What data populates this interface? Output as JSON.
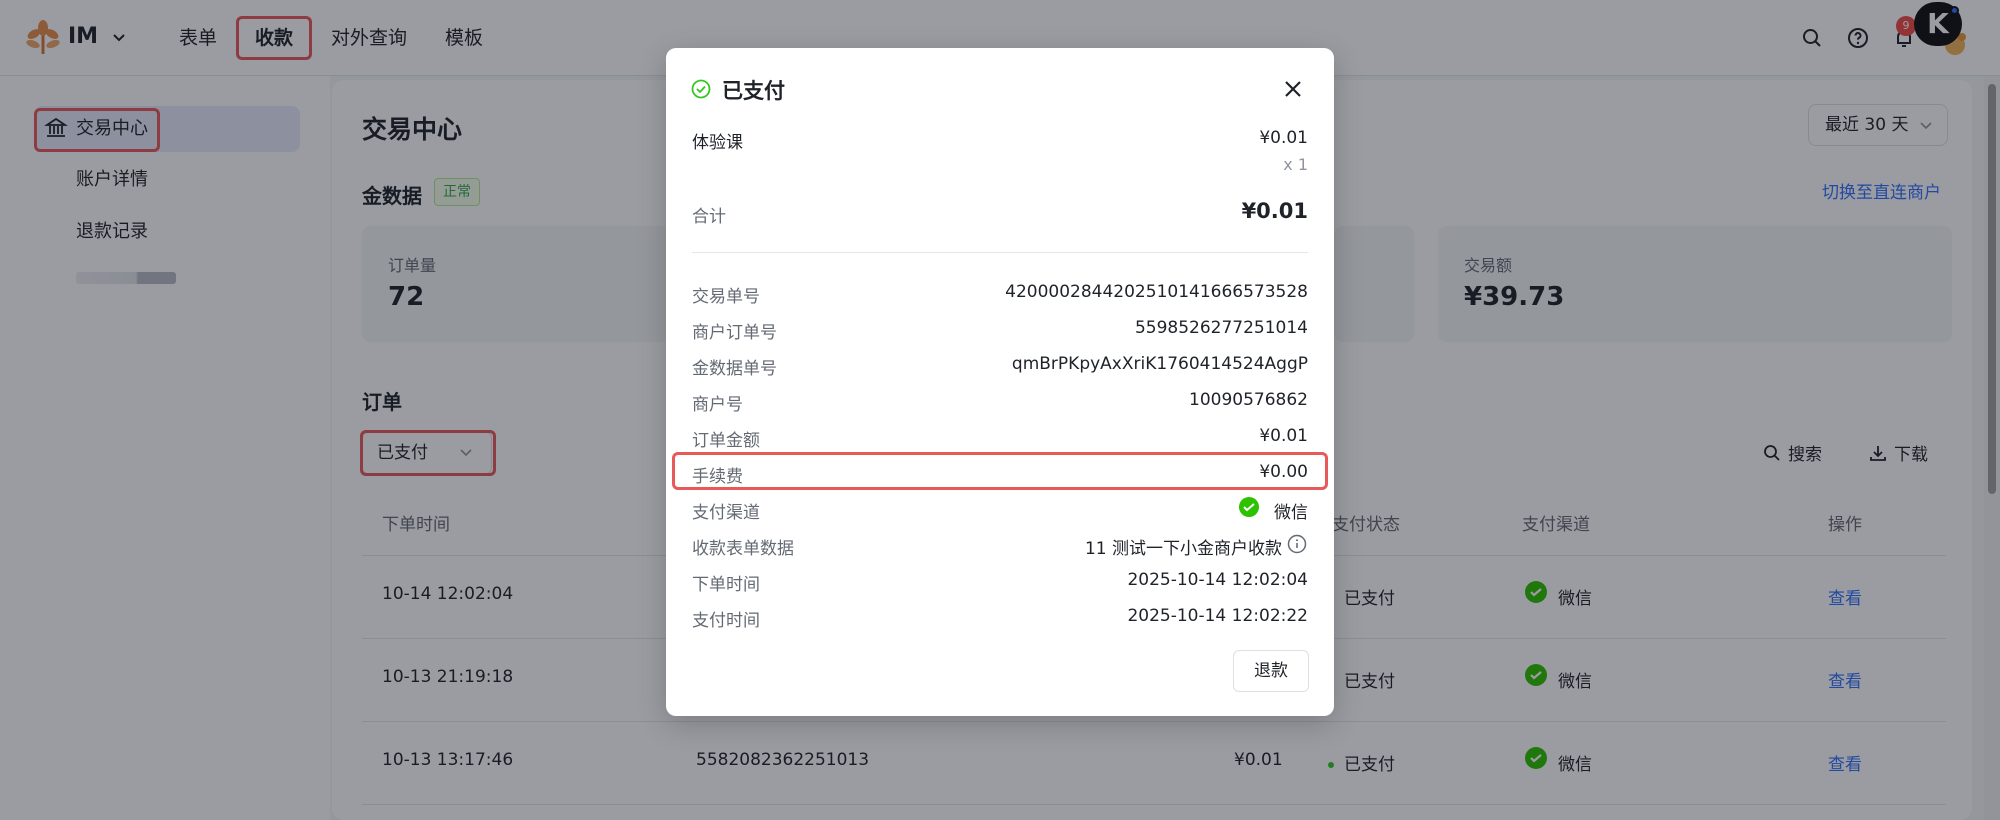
{
  "app": {
    "name": "IM"
  },
  "nav": [
    "表单",
    "收款",
    "对外查询",
    "模板"
  ],
  "header": {
    "notification_count": "9",
    "avatar_letter": "K"
  },
  "sidebar": {
    "items": [
      "交易中心",
      "账户详情",
      "退款记录"
    ]
  },
  "main": {
    "title": "交易中心",
    "range": "最近 30 天",
    "section": "金数据",
    "status_tag": "正常",
    "switch_link": "切换至直连商户",
    "stats": [
      {
        "label": "订单量",
        "value": "72"
      },
      {
        "label": "交易额",
        "value": "¥39.73"
      }
    ],
    "orders_title": "订单",
    "filter_value": "已支付",
    "search_label": "搜索",
    "download_label": "下载",
    "columns": [
      "下单时间",
      "支付状态",
      "支付渠道",
      "操作"
    ],
    "rows": [
      {
        "time": "10-14 12:02:04",
        "status": "已支付",
        "channel": "微信",
        "action": "查看"
      },
      {
        "time": "10-13 21:19:18",
        "status": "已支付",
        "channel": "微信",
        "action": "查看"
      },
      {
        "time": "10-13 13:17:46",
        "order_no": "5582082362251013",
        "amount": "¥0.01",
        "status": "已支付",
        "channel": "微信",
        "action": "查看"
      }
    ]
  },
  "modal": {
    "title": "已支付",
    "product_name": "体验课",
    "product_price": "¥0.01",
    "product_qty": "x 1",
    "total_label": "合计",
    "total_value": "¥0.01",
    "details": [
      {
        "label": "交易单号",
        "value": "4200002844202510141666573528"
      },
      {
        "label": "商户订单号",
        "value": "5598526277251014"
      },
      {
        "label": "金数据单号",
        "value": "qmBrPKpyAxXriK1760414524AggP"
      },
      {
        "label": "商户号",
        "value": "10090576862"
      },
      {
        "label": "订单金额",
        "value": "¥0.01"
      },
      {
        "label": "手续费",
        "value": "¥0.00"
      },
      {
        "label": "支付渠道",
        "value": "微信"
      },
      {
        "label": "收款表单数据",
        "value": "11 测试一下小金商户收款"
      },
      {
        "label": "下单时间",
        "value": "2025-10-14 12:02:04"
      },
      {
        "label": "支付时间",
        "value": "2025-10-14 12:02:22"
      }
    ],
    "refund_label": "退款"
  },
  "colors": {
    "accent": "#3370ff",
    "highlight": "#e85a5a",
    "success": "#34c724",
    "wechat": "#2dc100"
  },
  "icons": [
    "logo-icon",
    "chevron-down-icon",
    "search-icon",
    "help-icon",
    "bell-icon",
    "bank-icon",
    "download-icon",
    "wechat-icon",
    "check-circle-icon",
    "close-icon",
    "info-icon"
  ]
}
